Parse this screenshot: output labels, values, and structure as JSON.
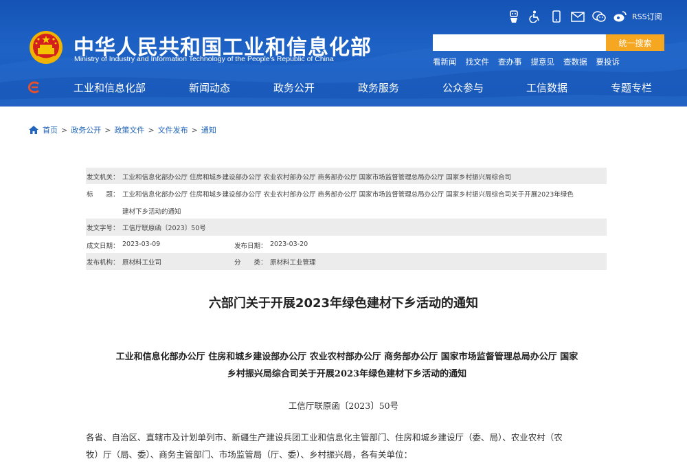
{
  "header": {
    "title": "中华人民共和国工业和信息化部",
    "subtitle": "Ministry of Industry and Information Technology of the People's Republic of China",
    "rss_label": "RSS订阅",
    "util_icons": [
      "robot-icon",
      "accessibility-icon",
      "mobile-icon",
      "mail-icon",
      "wechat-icon",
      "weibo-icon",
      "rss-icon"
    ],
    "search": {
      "placeholder": "",
      "button": "统一搜索"
    },
    "quick_links": [
      "看新闻",
      "找文件",
      "查办事",
      "提意见",
      "查数据",
      "要投诉"
    ]
  },
  "nav": {
    "items": [
      "工业和信息化部",
      "新闻动态",
      "政务公开",
      "政务服务",
      "公众参与",
      "工信数据",
      "专题专栏"
    ]
  },
  "breadcrumb": {
    "items": [
      "首页",
      "政务公开",
      "政策文件",
      "文件发布",
      "通知"
    ],
    "separator": ">"
  },
  "meta": {
    "issuer_label": "发文机关：",
    "issuer": "工业和信息化部办公厅 住房和城乡建设部办公厅 农业农村部办公厅 商务部办公厅 国家市场监督管理总局办公厅 国家乡村振兴局综合司",
    "title_label": "标　　题：",
    "title_line1": "工业和信息化部办公厅 住房和城乡建设部办公厅 农业农村部办公厅 商务部办公厅 国家市场监督管理总局办公厅 国家乡村振兴局综合司关于开展2023年绿色",
    "title_line2": "建材下乡活动的通知",
    "doc_no_label": "发文字号：",
    "doc_no": "工信厅联原函〔2023〕50号",
    "date_label": "成文日期：",
    "date": "2023-03-09",
    "pub_label": "发布日期：",
    "pub_date": "2023-03-20",
    "org_label": "发布机构：",
    "org": "原材料工业司",
    "cat_label": "分　　类：",
    "category": "原材料工业管理"
  },
  "article": {
    "title": "六部门关于开展2023年绿色建材下乡活动的通知",
    "heading_line1": "工业和信息化部办公厅 住房和城乡建设部办公厅 农业农村部办公厅 商务部办公厅 国家市场监督管理总局办公厅 国家",
    "heading_line2": "乡村振兴局综合司关于开展2023年绿色建材下乡活动的通知",
    "doc_number": "工信厅联原函〔2023〕50号",
    "para1_line1": "各省、自治区、直辖市及计划单列市、新疆生产建设兵团工业和信息化主管部门、住房和城乡建设厅（委、局）、农业农村（农",
    "para1_line2": "牧）厅（局、委）、商务主管部门、市场监管局（厅、委）、乡村振兴局，各有关单位："
  },
  "colors": {
    "header_blue": "#1a5bbd",
    "search_button": "#f5a722",
    "link_blue": "#2266bb",
    "meta_shade": "#ececec"
  }
}
